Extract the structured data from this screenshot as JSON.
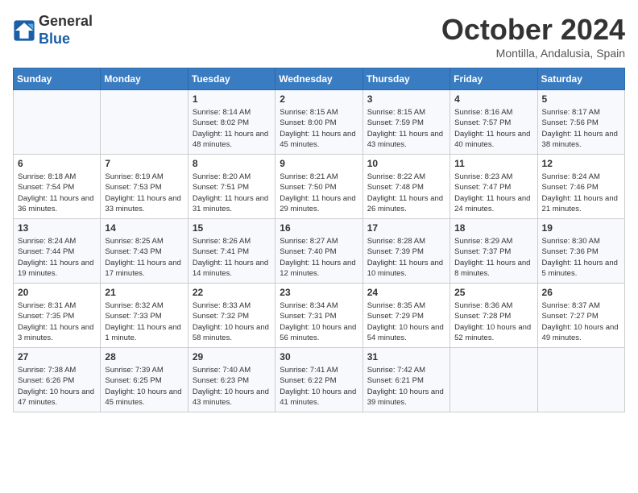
{
  "header": {
    "logo_line1": "General",
    "logo_line2": "Blue",
    "month": "October 2024",
    "location": "Montilla, Andalusia, Spain"
  },
  "weekdays": [
    "Sunday",
    "Monday",
    "Tuesday",
    "Wednesday",
    "Thursday",
    "Friday",
    "Saturday"
  ],
  "weeks": [
    [
      {
        "day": "",
        "sunrise": "",
        "sunset": "",
        "daylight": ""
      },
      {
        "day": "",
        "sunrise": "",
        "sunset": "",
        "daylight": ""
      },
      {
        "day": "1",
        "sunrise": "Sunrise: 8:14 AM",
        "sunset": "Sunset: 8:02 PM",
        "daylight": "Daylight: 11 hours and 48 minutes."
      },
      {
        "day": "2",
        "sunrise": "Sunrise: 8:15 AM",
        "sunset": "Sunset: 8:00 PM",
        "daylight": "Daylight: 11 hours and 45 minutes."
      },
      {
        "day": "3",
        "sunrise": "Sunrise: 8:15 AM",
        "sunset": "Sunset: 7:59 PM",
        "daylight": "Daylight: 11 hours and 43 minutes."
      },
      {
        "day": "4",
        "sunrise": "Sunrise: 8:16 AM",
        "sunset": "Sunset: 7:57 PM",
        "daylight": "Daylight: 11 hours and 40 minutes."
      },
      {
        "day": "5",
        "sunrise": "Sunrise: 8:17 AM",
        "sunset": "Sunset: 7:56 PM",
        "daylight": "Daylight: 11 hours and 38 minutes."
      }
    ],
    [
      {
        "day": "6",
        "sunrise": "Sunrise: 8:18 AM",
        "sunset": "Sunset: 7:54 PM",
        "daylight": "Daylight: 11 hours and 36 minutes."
      },
      {
        "day": "7",
        "sunrise": "Sunrise: 8:19 AM",
        "sunset": "Sunset: 7:53 PM",
        "daylight": "Daylight: 11 hours and 33 minutes."
      },
      {
        "day": "8",
        "sunrise": "Sunrise: 8:20 AM",
        "sunset": "Sunset: 7:51 PM",
        "daylight": "Daylight: 11 hours and 31 minutes."
      },
      {
        "day": "9",
        "sunrise": "Sunrise: 8:21 AM",
        "sunset": "Sunset: 7:50 PM",
        "daylight": "Daylight: 11 hours and 29 minutes."
      },
      {
        "day": "10",
        "sunrise": "Sunrise: 8:22 AM",
        "sunset": "Sunset: 7:48 PM",
        "daylight": "Daylight: 11 hours and 26 minutes."
      },
      {
        "day": "11",
        "sunrise": "Sunrise: 8:23 AM",
        "sunset": "Sunset: 7:47 PM",
        "daylight": "Daylight: 11 hours and 24 minutes."
      },
      {
        "day": "12",
        "sunrise": "Sunrise: 8:24 AM",
        "sunset": "Sunset: 7:46 PM",
        "daylight": "Daylight: 11 hours and 21 minutes."
      }
    ],
    [
      {
        "day": "13",
        "sunrise": "Sunrise: 8:24 AM",
        "sunset": "Sunset: 7:44 PM",
        "daylight": "Daylight: 11 hours and 19 minutes."
      },
      {
        "day": "14",
        "sunrise": "Sunrise: 8:25 AM",
        "sunset": "Sunset: 7:43 PM",
        "daylight": "Daylight: 11 hours and 17 minutes."
      },
      {
        "day": "15",
        "sunrise": "Sunrise: 8:26 AM",
        "sunset": "Sunset: 7:41 PM",
        "daylight": "Daylight: 11 hours and 14 minutes."
      },
      {
        "day": "16",
        "sunrise": "Sunrise: 8:27 AM",
        "sunset": "Sunset: 7:40 PM",
        "daylight": "Daylight: 11 hours and 12 minutes."
      },
      {
        "day": "17",
        "sunrise": "Sunrise: 8:28 AM",
        "sunset": "Sunset: 7:39 PM",
        "daylight": "Daylight: 11 hours and 10 minutes."
      },
      {
        "day": "18",
        "sunrise": "Sunrise: 8:29 AM",
        "sunset": "Sunset: 7:37 PM",
        "daylight": "Daylight: 11 hours and 8 minutes."
      },
      {
        "day": "19",
        "sunrise": "Sunrise: 8:30 AM",
        "sunset": "Sunset: 7:36 PM",
        "daylight": "Daylight: 11 hours and 5 minutes."
      }
    ],
    [
      {
        "day": "20",
        "sunrise": "Sunrise: 8:31 AM",
        "sunset": "Sunset: 7:35 PM",
        "daylight": "Daylight: 11 hours and 3 minutes."
      },
      {
        "day": "21",
        "sunrise": "Sunrise: 8:32 AM",
        "sunset": "Sunset: 7:33 PM",
        "daylight": "Daylight: 11 hours and 1 minute."
      },
      {
        "day": "22",
        "sunrise": "Sunrise: 8:33 AM",
        "sunset": "Sunset: 7:32 PM",
        "daylight": "Daylight: 10 hours and 58 minutes."
      },
      {
        "day": "23",
        "sunrise": "Sunrise: 8:34 AM",
        "sunset": "Sunset: 7:31 PM",
        "daylight": "Daylight: 10 hours and 56 minutes."
      },
      {
        "day": "24",
        "sunrise": "Sunrise: 8:35 AM",
        "sunset": "Sunset: 7:29 PM",
        "daylight": "Daylight: 10 hours and 54 minutes."
      },
      {
        "day": "25",
        "sunrise": "Sunrise: 8:36 AM",
        "sunset": "Sunset: 7:28 PM",
        "daylight": "Daylight: 10 hours and 52 minutes."
      },
      {
        "day": "26",
        "sunrise": "Sunrise: 8:37 AM",
        "sunset": "Sunset: 7:27 PM",
        "daylight": "Daylight: 10 hours and 49 minutes."
      }
    ],
    [
      {
        "day": "27",
        "sunrise": "Sunrise: 7:38 AM",
        "sunset": "Sunset: 6:26 PM",
        "daylight": "Daylight: 10 hours and 47 minutes."
      },
      {
        "day": "28",
        "sunrise": "Sunrise: 7:39 AM",
        "sunset": "Sunset: 6:25 PM",
        "daylight": "Daylight: 10 hours and 45 minutes."
      },
      {
        "day": "29",
        "sunrise": "Sunrise: 7:40 AM",
        "sunset": "Sunset: 6:23 PM",
        "daylight": "Daylight: 10 hours and 43 minutes."
      },
      {
        "day": "30",
        "sunrise": "Sunrise: 7:41 AM",
        "sunset": "Sunset: 6:22 PM",
        "daylight": "Daylight: 10 hours and 41 minutes."
      },
      {
        "day": "31",
        "sunrise": "Sunrise: 7:42 AM",
        "sunset": "Sunset: 6:21 PM",
        "daylight": "Daylight: 10 hours and 39 minutes."
      },
      {
        "day": "",
        "sunrise": "",
        "sunset": "",
        "daylight": ""
      },
      {
        "day": "",
        "sunrise": "",
        "sunset": "",
        "daylight": ""
      }
    ]
  ]
}
